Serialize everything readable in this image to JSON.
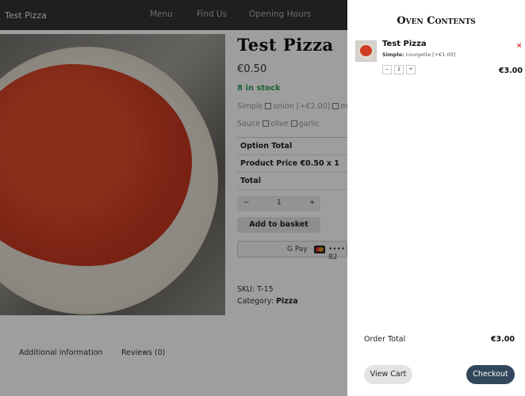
{
  "site": {
    "title": "Test Pizza",
    "nav": [
      "Menu",
      "Find Us",
      "Opening Hours"
    ]
  },
  "product": {
    "title": "Test Pizza",
    "price": "€0.50",
    "stock": "8 in stock",
    "simple_label": "Simple",
    "simple_options": [
      "onion [+€2.00]",
      "mus"
    ],
    "sauce_label": "Sauce",
    "sauce_options": [
      "olive",
      "garlic"
    ],
    "totals": [
      "Option Total",
      "Product Price €0.50 x 1",
      "Total"
    ],
    "quantity": "1",
    "minus": "−",
    "plus": "+",
    "add_to_basket": "Add to basket",
    "gpay": "G Pay",
    "card_digits": "•••• 82",
    "sku": "SKU: T-15",
    "category_label": "Category:",
    "category_value": "Pizza",
    "tabs": [
      "Additional information",
      "Reviews (0)"
    ]
  },
  "cart": {
    "title": "Oven Contents",
    "item": {
      "name": "Test Pizza",
      "meta_label": "Simple:",
      "meta_value": "courgette [+€1.00]",
      "qty": "2",
      "minus": "−",
      "plus": "+",
      "remove": "×",
      "price": "€3.00"
    },
    "order_total_label": "Order Total",
    "order_total_value": "€3.00",
    "view_cart": "View Cart",
    "checkout": "Checkout"
  },
  "colors": {
    "stock_green": "#2f9a55",
    "checkout_bg": "#32475b",
    "remove_red": "#dd2222"
  }
}
